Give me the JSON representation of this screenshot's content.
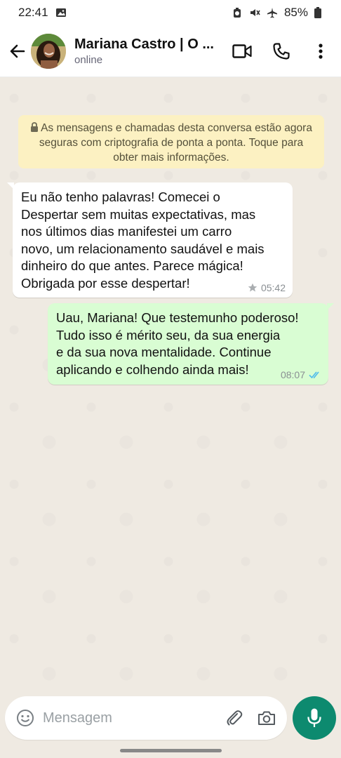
{
  "status_bar": {
    "time": "22:41",
    "battery": "85%"
  },
  "header": {
    "contact_name": "Mariana Castro | O ...",
    "contact_status": "online"
  },
  "chat": {
    "e2e_notice": "As mensagens e chamadas desta conversa estão agora seguras com criptografia de ponta a ponta. Toque para obter mais informações.",
    "messages": [
      {
        "direction": "incoming",
        "text": "Eu não tenho palavras! Comecei o\nDespertar sem muitas expectativas, mas\nnos últimos dias manifestei um carro\nnovo, um relacionamento saudável e mais\ndinheiro do que antes. Parece mágica!\nObrigada por esse despertar!",
        "time": "05:42",
        "starred": true
      },
      {
        "direction": "outgoing",
        "text": "Uau, Mariana! Que testemunho poderoso!\nTudo isso é mérito seu, da sua energia\ne da sua nova mentalidade. Continue\naplicando e colhendo ainda mais!",
        "time": "08:07",
        "read": true
      }
    ]
  },
  "composer": {
    "placeholder": "Mensagem"
  },
  "colors": {
    "accent": "#0d8a6f",
    "outgoing_bubble": "#d9fdd3",
    "notice_bg": "#fcf1c2",
    "read_ticks": "#53bdeb"
  }
}
